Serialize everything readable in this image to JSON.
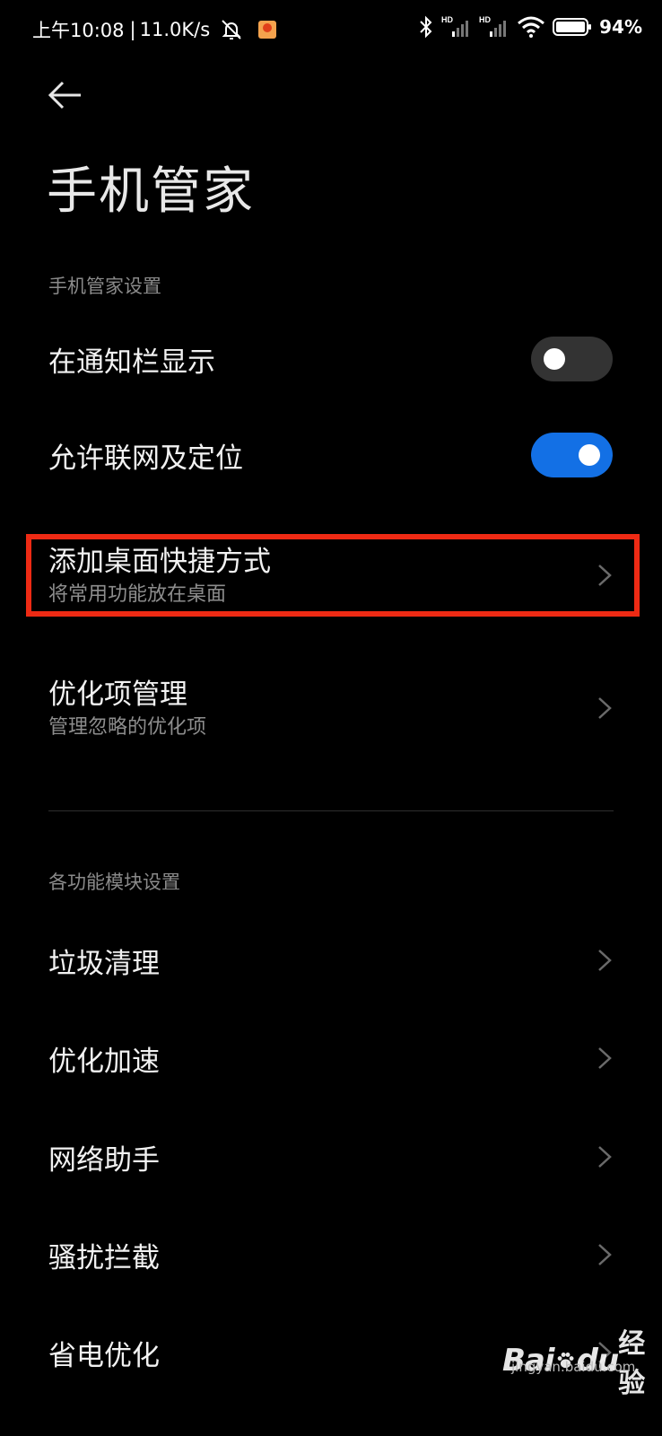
{
  "status_bar": {
    "time": "上午10:08",
    "separator": "|",
    "net_speed": "11.0K/s",
    "hd1": "HD",
    "hd2": "HD",
    "battery_percent": "94%"
  },
  "page": {
    "title": "手机管家"
  },
  "section1": {
    "header": "手机管家设置",
    "show_in_notification": {
      "label": "在通知栏显示",
      "enabled": false
    },
    "allow_network_location": {
      "label": "允许联网及定位",
      "enabled": true
    },
    "add_shortcut": {
      "label": "添加桌面快捷方式",
      "sub": "将常用功能放在桌面"
    },
    "optimization_manage": {
      "label": "优化项管理",
      "sub": "管理忽略的优化项"
    }
  },
  "section2": {
    "header": "各功能模块设置",
    "items": [
      {
        "label": "垃圾清理"
      },
      {
        "label": "优化加速"
      },
      {
        "label": "网络助手"
      },
      {
        "label": "骚扰拦截"
      },
      {
        "label": "省电优化"
      }
    ]
  },
  "watermark": {
    "brand": "Bai",
    "du": "du",
    "suffix": "经验",
    "url": "jingyan.baidu.com"
  },
  "colors": {
    "background": "#000000",
    "toggle_on": "#1370e5",
    "toggle_off": "#333333",
    "highlight": "#ee2a14"
  }
}
